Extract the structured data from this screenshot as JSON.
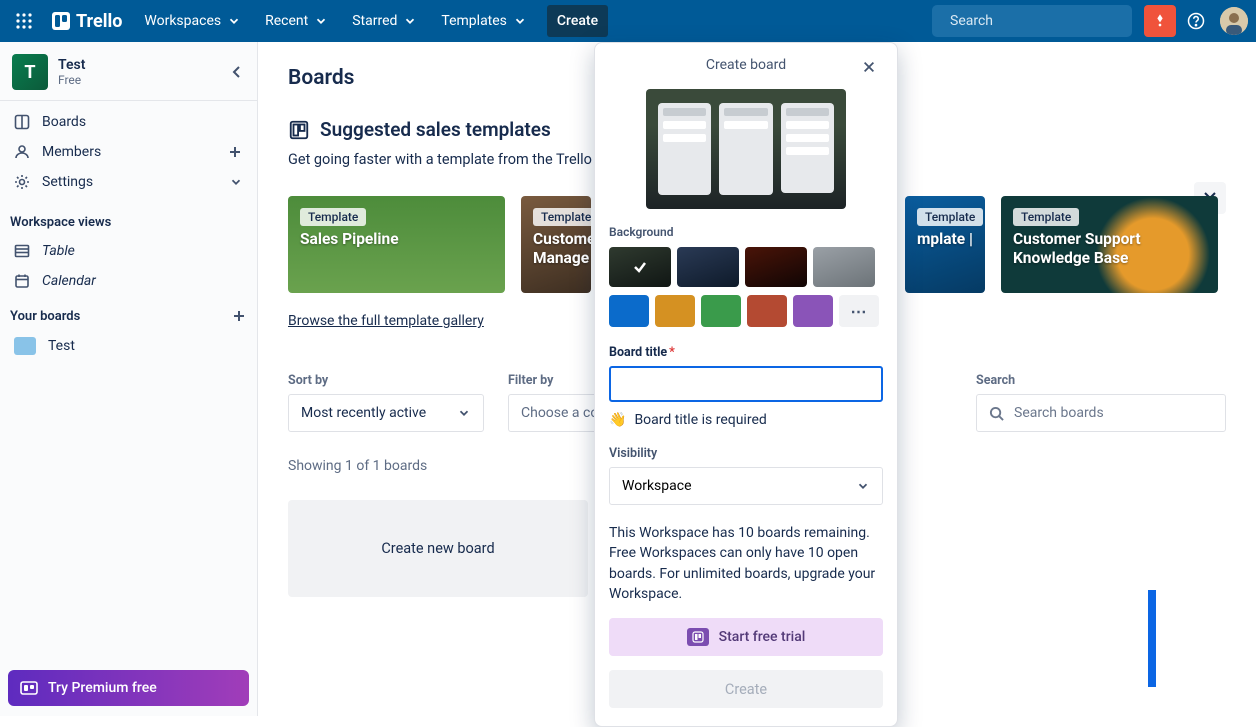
{
  "topbar": {
    "logo_text": "Trello",
    "nav": {
      "workspaces": "Workspaces",
      "recent": "Recent",
      "starred": "Starred",
      "templates": "Templates",
      "create": "Create"
    },
    "search_placeholder": "Search"
  },
  "sidebar": {
    "workspace": {
      "initial": "T",
      "name": "Test",
      "plan": "Free"
    },
    "items": {
      "boards": "Boards",
      "members": "Members",
      "settings": "Settings"
    },
    "views_heading": "Workspace views",
    "views": {
      "table": "Table",
      "calendar": "Calendar"
    },
    "your_boards_heading": "Your boards",
    "boards": [
      {
        "name": "Test"
      }
    ],
    "premium_cta": "Try Premium free"
  },
  "main": {
    "title": "Boards",
    "suggested_heading": "Suggested sales templates",
    "suggested_sub": "Get going faster with a template from the Trello",
    "templates": [
      {
        "pill": "Template",
        "title": "Sales Pipeline"
      },
      {
        "pill": "Template",
        "title": "Customer Manage"
      },
      {
        "pill": "Template",
        "title": "mplate |"
      },
      {
        "pill": "Template",
        "title": "Customer Support Knowledge Base"
      }
    ],
    "browse_link": "Browse the full template gallery",
    "sort_label": "Sort by",
    "sort_value": "Most recently active",
    "filter_label": "Filter by",
    "filter_placeholder": "Choose a colle",
    "search_label": "Search",
    "search_placeholder": "Search boards",
    "showing_text": "Showing 1 of 1 boards",
    "create_tile": "Create new board"
  },
  "popover": {
    "title": "Create board",
    "background_label": "Background",
    "images": [
      {
        "bg": "linear-gradient(160deg,#2f3a2f,#101614)",
        "selected": true
      },
      {
        "bg": "linear-gradient(160deg,#2a3a55,#0e1a2a)",
        "selected": false
      },
      {
        "bg": "linear-gradient(160deg,#4a1408,#100504)",
        "selected": false
      },
      {
        "bg": "linear-gradient(160deg,#9aa0a6,#6c7378)",
        "selected": false
      }
    ],
    "colors": [
      "#0b6bcb",
      "#d59122",
      "#3a9b4b",
      "#b44a32",
      "#8a54b8"
    ],
    "board_title_label": "Board title",
    "board_title_required_hint": "Board title is required",
    "visibility_label": "Visibility",
    "visibility_value": "Workspace",
    "note": "This Workspace has 10 boards remaining. Free Workspaces can only have 10 open boards. For unlimited boards, upgrade your Workspace.",
    "trial_cta": "Start free trial",
    "create_button": "Create",
    "wave_emoji": "👋"
  }
}
